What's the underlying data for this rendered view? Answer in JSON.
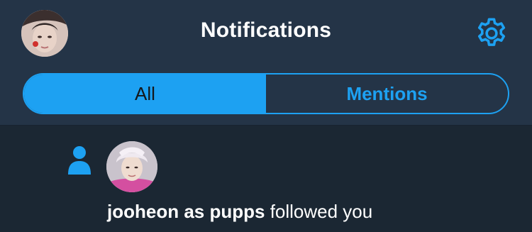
{
  "header": {
    "title": "Notifications"
  },
  "tabs": [
    {
      "label": "All",
      "active": true
    },
    {
      "label": "Mentions",
      "active": false
    }
  ],
  "notification": {
    "user_name": "jooheon as pupps",
    "action": "followed you",
    "type_icon": "person-icon"
  },
  "colors": {
    "accent": "#1da1f2",
    "header_bg": "#243447",
    "feed_bg": "#1b2733",
    "text": "#ffffff"
  }
}
